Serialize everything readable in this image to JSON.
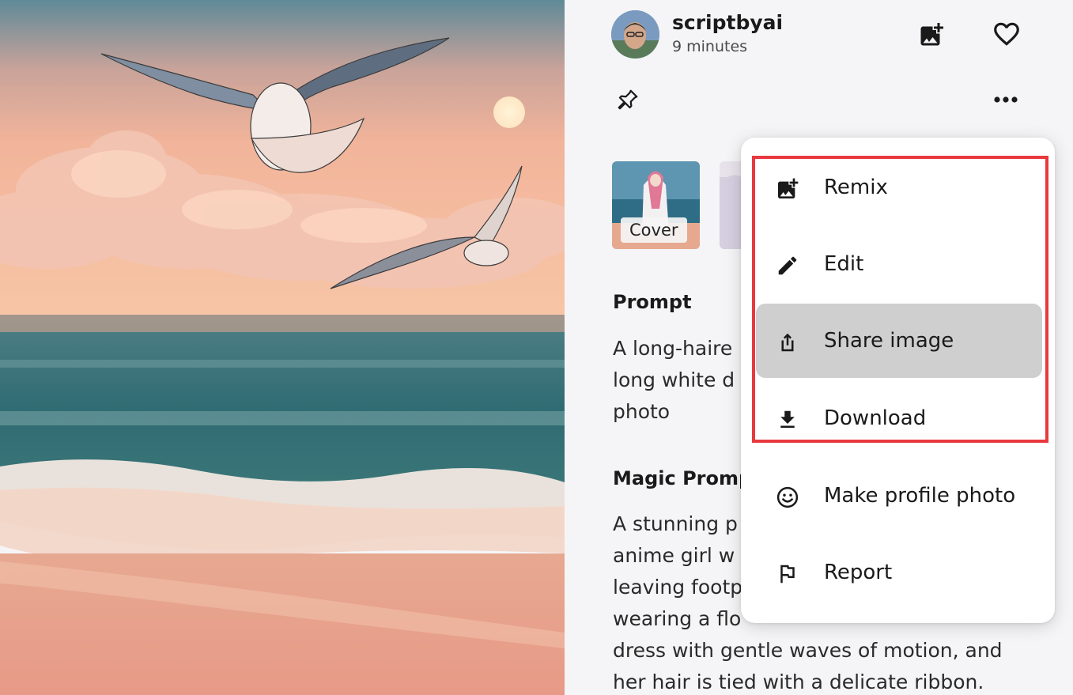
{
  "user": {
    "username": "scriptbyai",
    "timestamp": "9 minutes"
  },
  "header_actions": {
    "remix_icon": "add-photo-icon",
    "like_icon": "heart-outline-icon",
    "pin_icon": "pin-icon",
    "more_icon": "more-horizontal-icon"
  },
  "thumbnails": [
    {
      "badge": "Cover"
    },
    {
      "badge": ""
    }
  ],
  "prompt": {
    "title": "Prompt",
    "lines": [
      "A long-haire",
      "long white d",
      "photo"
    ]
  },
  "magic_prompt": {
    "title": "Magic Promp",
    "lines": [
      "A stunning p",
      "anime girl w",
      "leaving footp",
      "wearing a flo",
      "dress with gentle waves of motion, and",
      "her hair is tied with a delicate ribbon."
    ]
  },
  "menu": {
    "items": [
      {
        "label": "Remix",
        "icon": "add-photo-icon"
      },
      {
        "label": "Edit",
        "icon": "pencil-icon"
      },
      {
        "label": "Share image",
        "icon": "share-icon",
        "active": true
      },
      {
        "label": "Download",
        "icon": "download-icon"
      },
      {
        "label": "Make profile photo",
        "icon": "smiley-icon"
      },
      {
        "label": "Report",
        "icon": "flag-icon"
      }
    ]
  },
  "colors": {
    "panel_bg": "#f5f5f7",
    "menu_bg": "#ffffff",
    "active_item_bg": "#cfcfcf",
    "highlight_border": "#e8393f",
    "text_primary": "#1a1a1a"
  }
}
